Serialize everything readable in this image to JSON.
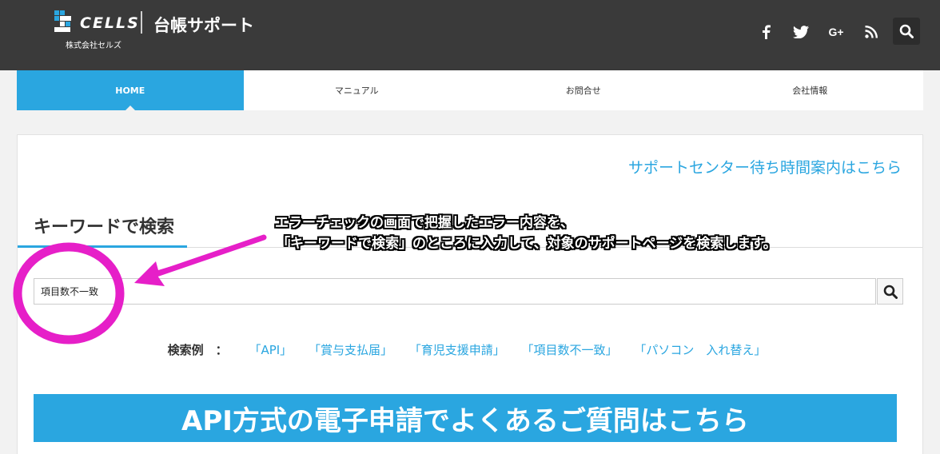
{
  "header": {
    "logo_text": "CELLS",
    "logo_subtitle": "株式会社セルズ",
    "site_title": "台帳サポート",
    "social": [
      {
        "icon": "facebook-icon",
        "glyph": "f"
      },
      {
        "icon": "twitter-icon",
        "glyph": "t"
      },
      {
        "icon": "google-plus-icon",
        "glyph": "G+"
      },
      {
        "icon": "rss-icon",
        "glyph": "rss"
      }
    ],
    "search_icon": "search-icon"
  },
  "nav": {
    "items": [
      {
        "label": "HOME",
        "active": true
      },
      {
        "label": "マニュアル",
        "active": false
      },
      {
        "label": "お問合せ",
        "active": false
      },
      {
        "label": "会社情報",
        "active": false
      }
    ]
  },
  "main": {
    "wait_time_link": "サポートセンター待ち時間案内はこちら",
    "keyword_title": "キーワードで検索",
    "search_value": "項目数不一致",
    "examples_label": "検索例　：",
    "examples": [
      "「API」",
      "「賞与支払届」",
      "「育児支援申請」",
      "「項目数不一致」",
      "「パソコン　入れ替え」"
    ],
    "api_banner": "API方式の電子申請でよくあるご質問はこちら"
  },
  "annotation": {
    "line1": "エラーチェックの画面で把握したエラー内容を、",
    "line2": "「キーワードで検索」のところに入力して、対象のサポートページを検索します。",
    "color": "#e61fc8"
  },
  "colors": {
    "header_bg": "#3a3a3a",
    "accent": "#2aa6e0",
    "page_bg": "#f2f2f2"
  }
}
